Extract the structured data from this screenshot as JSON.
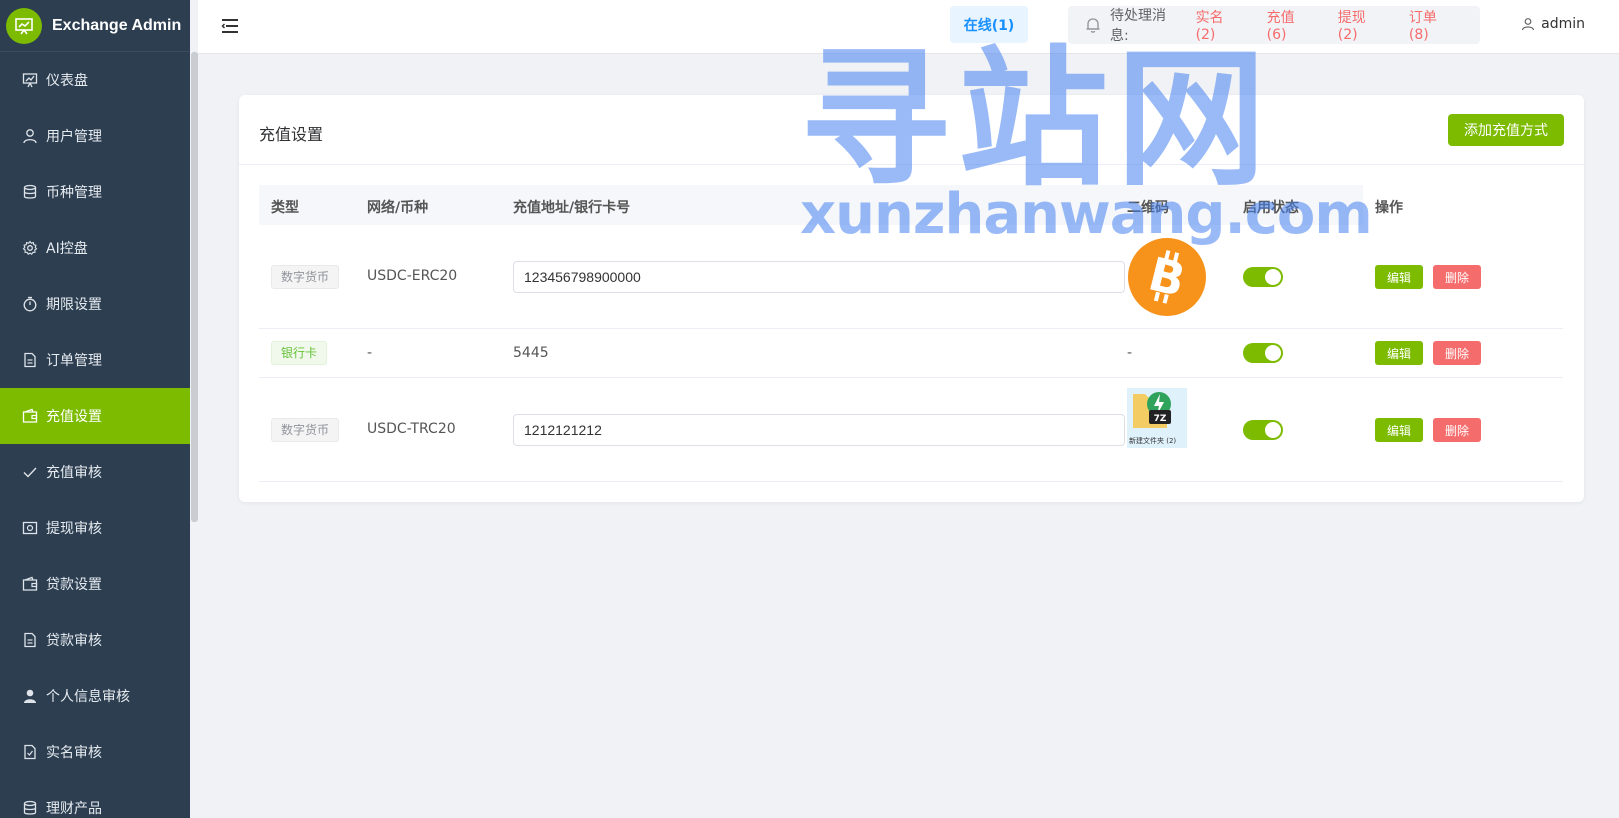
{
  "app": {
    "title": "Exchange Admin"
  },
  "sidebar": {
    "items": [
      {
        "label": "仪表盘",
        "icon": "dashboard-icon",
        "active": false
      },
      {
        "label": "用户管理",
        "icon": "user-icon",
        "active": false
      },
      {
        "label": "币种管理",
        "icon": "database-icon",
        "active": false
      },
      {
        "label": "AI控盘",
        "icon": "gear-icon",
        "active": false
      },
      {
        "label": "期限设置",
        "icon": "timer-icon",
        "active": false
      },
      {
        "label": "订单管理",
        "icon": "document-icon",
        "active": false
      },
      {
        "label": "充值设置",
        "icon": "wallet-icon",
        "active": true
      },
      {
        "label": "充值审核",
        "icon": "check-icon",
        "active": false
      },
      {
        "label": "提现审核",
        "icon": "money-icon",
        "active": false
      },
      {
        "label": "贷款设置",
        "icon": "wallet-icon",
        "active": false
      },
      {
        "label": "贷款审核",
        "icon": "document-icon",
        "active": false
      },
      {
        "label": "个人信息审核",
        "icon": "person-icon",
        "active": false
      },
      {
        "label": "实名审核",
        "icon": "doc-check-icon",
        "active": false
      },
      {
        "label": "理财产品",
        "icon": "database-icon",
        "active": false
      }
    ]
  },
  "header": {
    "online": "在线(1)",
    "pending_label": "待处理消息:",
    "pending_items": [
      "实名(2)",
      "充值(6)",
      "提现(2)",
      "订单(8)"
    ],
    "user": "admin"
  },
  "card": {
    "title": "充值设置",
    "add_button": "添加充值方式"
  },
  "table": {
    "headers": [
      "类型",
      "网络/币种",
      "充值地址/银行卡号",
      "二维码",
      "启用状态",
      "操作"
    ],
    "rows": [
      {
        "type": "数字货币",
        "network": "USDC-ERC20",
        "address": "123456798900000",
        "qr": "bitcoin-icon",
        "enabled": true
      },
      {
        "type": "银行卡",
        "network": "-",
        "address": "5445",
        "qr": "-",
        "enabled": true
      },
      {
        "type": "数字货币",
        "network": "USDC-TRC20",
        "address": "1212121212",
        "qr": "folder-thumbnail",
        "qr_caption": "新建文件夹 (2)",
        "enabled": true
      }
    ],
    "edit_label": "编辑",
    "delete_label": "删除"
  },
  "watermark": {
    "big": "寻站网",
    "small": "xunzhanwang.com"
  },
  "colors": {
    "accent": "#7cbb00",
    "sidebar": "#2c3e50",
    "danger": "#f56c6c",
    "primary": "#1890ff"
  }
}
